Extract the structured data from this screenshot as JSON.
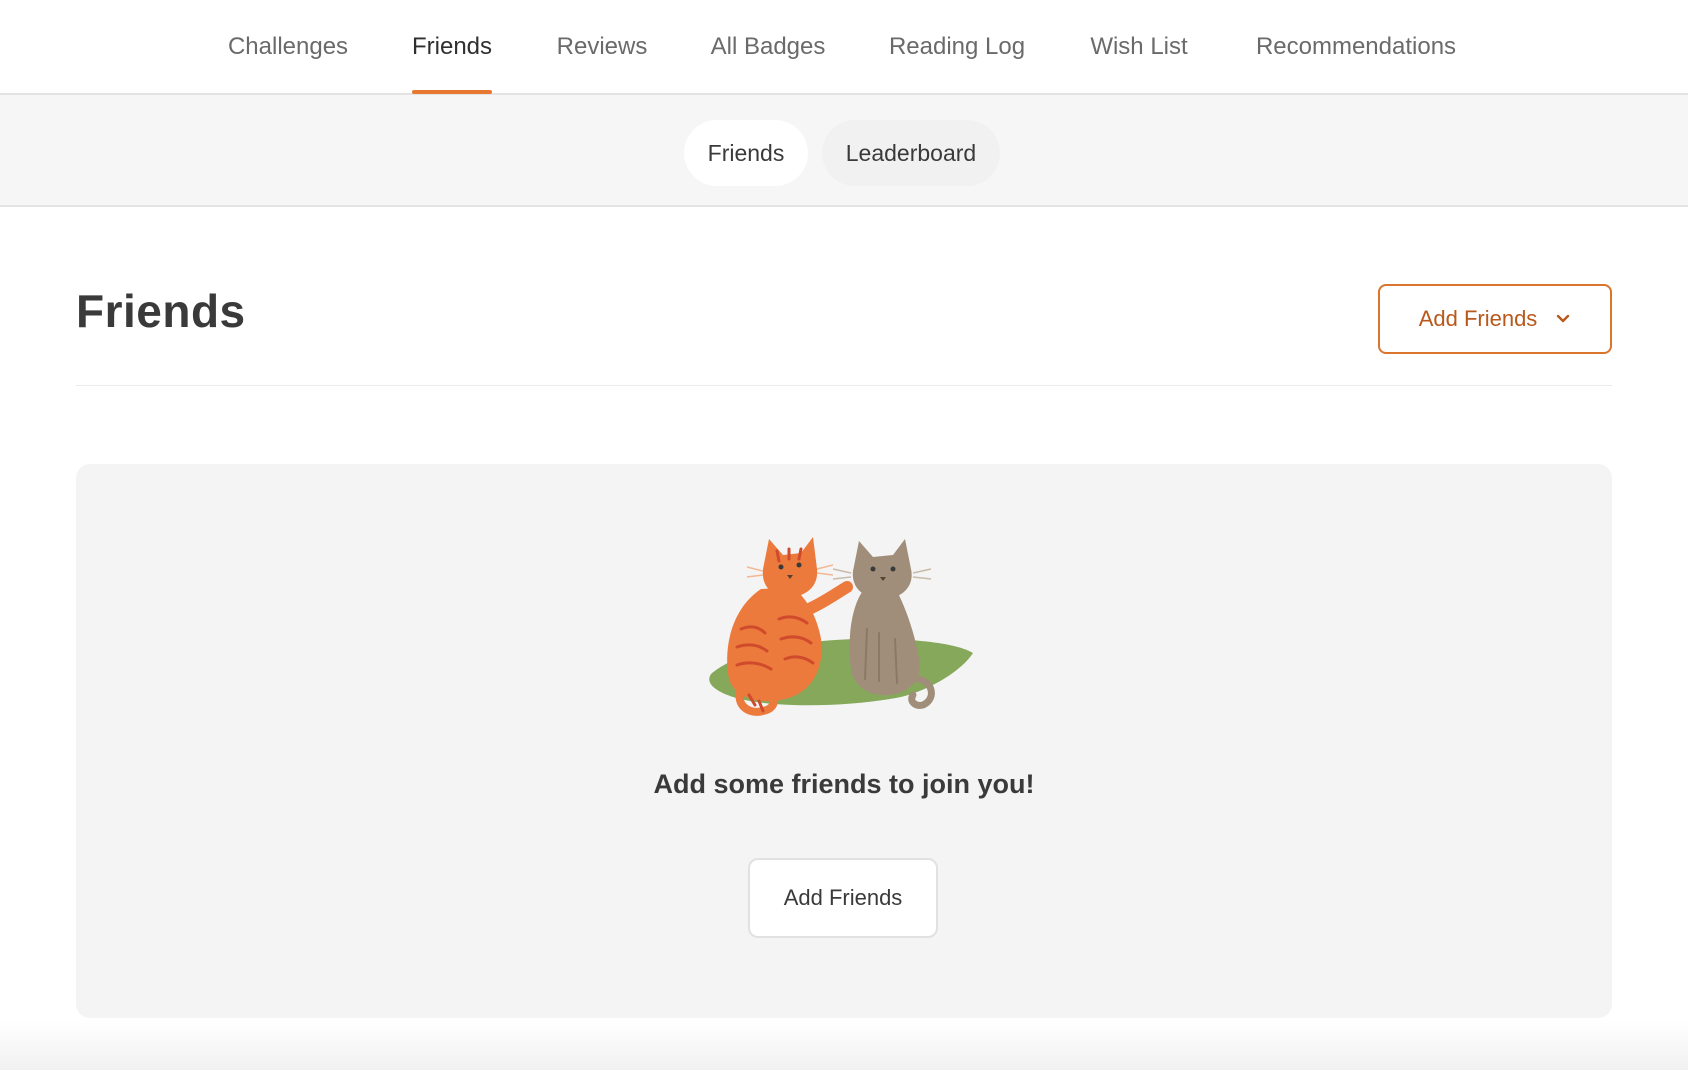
{
  "nav": {
    "items": [
      {
        "label": "Challenges",
        "active": false
      },
      {
        "label": "Friends",
        "active": true
      },
      {
        "label": "Reviews",
        "active": false
      },
      {
        "label": "All Badges",
        "active": false
      },
      {
        "label": "Reading Log",
        "active": false
      },
      {
        "label": "Wish List",
        "active": false
      },
      {
        "label": "Recommendations",
        "active": false
      }
    ]
  },
  "subnav": {
    "friends_label": "Friends",
    "leaderboard_label": "Leaderboard",
    "active": "Friends"
  },
  "header": {
    "title": "Friends",
    "add_friends_label": "Add Friends",
    "dropdown_icon": "chevron-down-icon"
  },
  "empty_state": {
    "illustration": "two-cats-illustration",
    "message": "Add some friends to join you!",
    "button_label": "Add Friends"
  },
  "colors": {
    "accent": "#e8782f",
    "accent_text": "#b8581b",
    "panel_bg": "#f4f4f4"
  }
}
